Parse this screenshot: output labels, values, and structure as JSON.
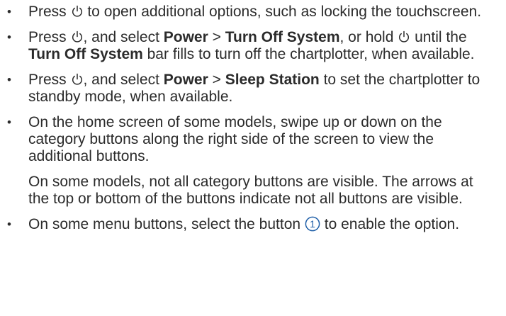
{
  "bullet_char": "•",
  "icons": {
    "power": "power-icon",
    "callout_1": "callout-number-icon"
  },
  "callout_color": "#1f5fa8",
  "items": [
    {
      "t1": "Press ",
      "t2": " to open additional options, such as locking the touchscreen."
    },
    {
      "t1": "Press ",
      "t2": ", and select ",
      "b1": "Power",
      "t3": " > ",
      "b2": "Turn Off System",
      "t4": ", or hold ",
      "t5": " until the ",
      "b3": "Turn Off System",
      "t6": " bar fills to turn off the chartplotter, when available."
    },
    {
      "t1": "Press ",
      "t2": ", and select ",
      "b1": "Power",
      "t3": " > ",
      "b2": "Sleep Station",
      "t4": " to set the chartplotter to standby mode, when available."
    },
    {
      "p1": "On the home screen of some models, swipe up or down on the category buttons along the right side of the screen to view the additional buttons.",
      "p2": "On some models, not all category buttons are visible. The arrows at the top or bottom of the buttons indicate not all buttons are visible."
    },
    {
      "t1": "On some menu buttons, select the button ",
      "callout": "1",
      "t2": " to enable the option."
    }
  ]
}
